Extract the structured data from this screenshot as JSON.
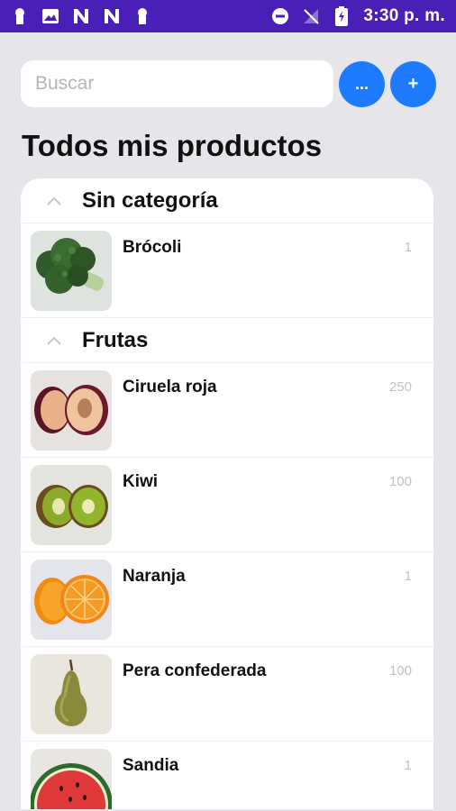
{
  "status_bar": {
    "time": "3:30 p. m.",
    "left_icons": [
      "keyhole-icon",
      "image-icon",
      "n-icon",
      "n-icon",
      "keyhole-icon"
    ],
    "right_icons": [
      "do-not-disturb-icon",
      "no-signal-icon",
      "battery-charging-icon"
    ],
    "color": "#4a1fb8"
  },
  "search": {
    "placeholder": "Buscar",
    "value": ""
  },
  "buttons": {
    "more_label": "...",
    "add_label": "+",
    "color": "#1e7bff"
  },
  "page_title": "Todos mis productos",
  "sections": [
    {
      "title": "Sin categoría",
      "items": [
        {
          "name": "Brócoli",
          "qty": "1",
          "image": "broccoli"
        }
      ]
    },
    {
      "title": "Frutas",
      "items": [
        {
          "name": "Ciruela roja",
          "qty": "250",
          "image": "plum"
        },
        {
          "name": "Kiwi",
          "qty": "100",
          "image": "kiwi"
        },
        {
          "name": "Naranja",
          "qty": "1",
          "image": "orange"
        },
        {
          "name": "Pera confederada",
          "qty": "100",
          "image": "pear"
        },
        {
          "name": "Sandia",
          "qty": "1",
          "image": "watermelon"
        }
      ]
    }
  ]
}
